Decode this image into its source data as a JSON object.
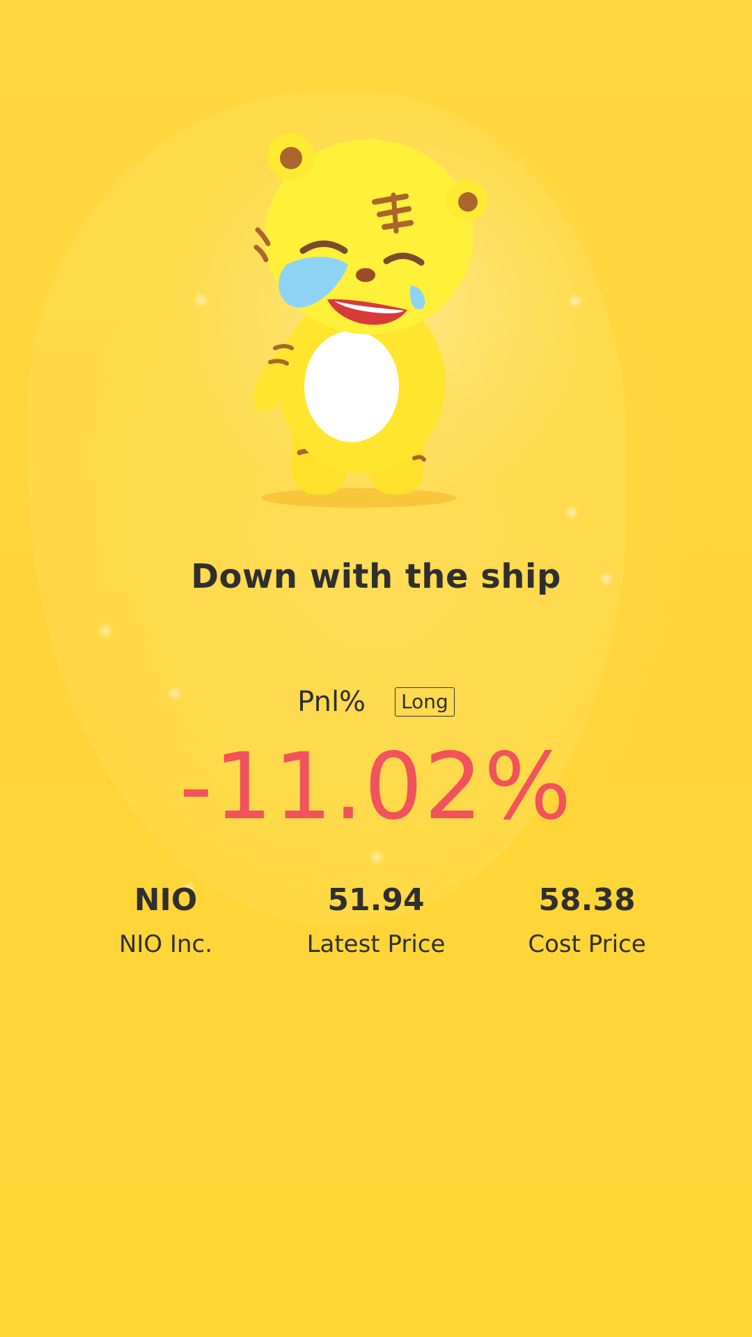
{
  "headline": "Down with the ship",
  "pnl": {
    "label": "Pnl%",
    "position_badge": "Long",
    "value": "-11.02%",
    "value_color": "#f2525c"
  },
  "stats": [
    {
      "value": "NIO",
      "label": "NIO Inc."
    },
    {
      "value": "51.94",
      "label": "Latest Price"
    },
    {
      "value": "58.38",
      "label": "Cost Price"
    }
  ],
  "mascot": {
    "icon": "crying-tiger-mascot-icon",
    "colors": {
      "body": "#ffe53a",
      "belly": "#ffffff",
      "stripes": "#b5651d",
      "tears": "#8fd3f4"
    }
  },
  "colors": {
    "background": "#ffd43a",
    "text": "#2f2f2f"
  }
}
